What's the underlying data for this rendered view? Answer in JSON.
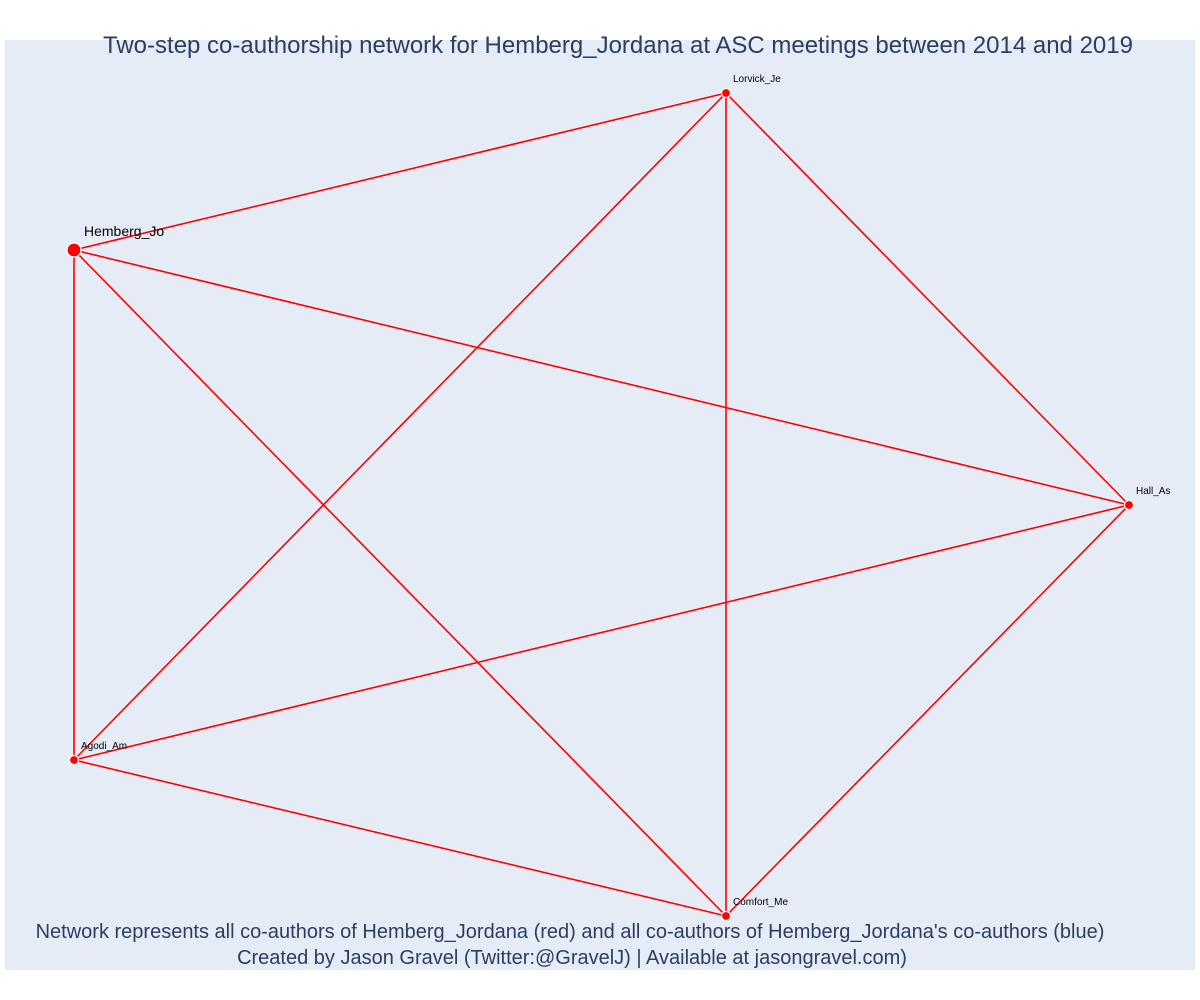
{
  "title": "Two-step co-authorship network for Hemberg_Jordana at ASC meetings between 2014 and 2019",
  "caption": {
    "line1": "Network represents all co-authors of Hemberg_Jordana (red) and all co-authors of Hemberg_Jordana's co-authors (blue)",
    "line2": "Created by Jason Gravel (Twitter:@GravelJ) | Available at jasongravel.com)"
  },
  "colors": {
    "plot_background": "#e5ecf6",
    "edge": "#ff0000",
    "node": "#ff0000",
    "node_outline": "#ffffff",
    "title_text": "#2a3f5f",
    "label_text": "#000000"
  },
  "network": {
    "nodes": [
      {
        "id": "hemberg",
        "label": "Hemberg_Jo",
        "focal": true
      },
      {
        "id": "lorvick",
        "label": "Lorvick_Je",
        "focal": false
      },
      {
        "id": "hall",
        "label": "Hall_As",
        "focal": false
      },
      {
        "id": "comfort",
        "label": "Comfort_Me",
        "focal": false
      },
      {
        "id": "agodi",
        "label": "Agodi_Am",
        "focal": false
      }
    ],
    "edges": [
      [
        "hemberg",
        "lorvick"
      ],
      [
        "hemberg",
        "hall"
      ],
      [
        "hemberg",
        "comfort"
      ],
      [
        "hemberg",
        "agodi"
      ],
      [
        "lorvick",
        "hall"
      ],
      [
        "lorvick",
        "comfort"
      ],
      [
        "lorvick",
        "agodi"
      ],
      [
        "hall",
        "comfort"
      ],
      [
        "hall",
        "agodi"
      ],
      [
        "comfort",
        "agodi"
      ]
    ]
  }
}
